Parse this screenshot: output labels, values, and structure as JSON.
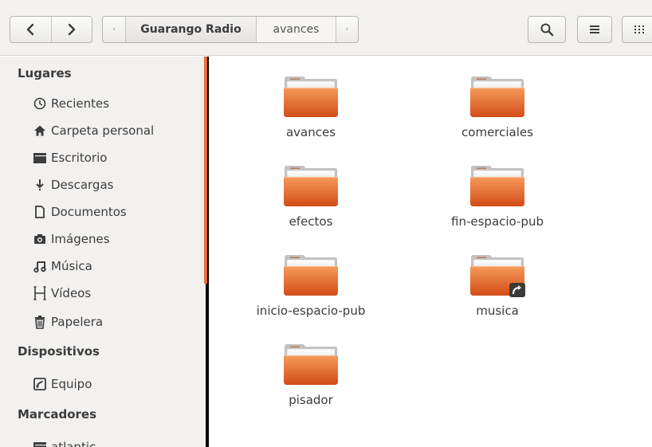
{
  "toolbar": {
    "back_icon": "chevron-left-icon",
    "forward_icon": "chevron-right-icon",
    "path_left_arrow": "‹",
    "path_right_arrow": "›",
    "breadcrumbs": [
      "Guarango Radio",
      "avances"
    ],
    "search_icon": "search-icon",
    "list_view_icon": "list-icon",
    "grid_view_icon": "grid-icon"
  },
  "sidebar": {
    "places_title": "Lugares",
    "places": [
      {
        "label": "Recientes",
        "icon": "clock-icon"
      },
      {
        "label": "Carpeta personal",
        "icon": "home-icon"
      },
      {
        "label": "Escritorio",
        "icon": "desktop-folder-icon"
      },
      {
        "label": "Descargas",
        "icon": "download-icon"
      },
      {
        "label": "Documentos",
        "icon": "document-icon"
      },
      {
        "label": "Imágenes",
        "icon": "camera-icon"
      },
      {
        "label": "Música",
        "icon": "music-icon"
      },
      {
        "label": "Vídeos",
        "icon": "film-icon"
      },
      {
        "label": "Papelera",
        "icon": "trash-icon"
      }
    ],
    "devices_title": "Dispositivos",
    "devices": [
      {
        "label": "Equipo",
        "icon": "drive-icon"
      }
    ],
    "bookmarks_title": "Marcadores",
    "bookmarks": [
      {
        "label": "atlantic",
        "icon": "folder-icon"
      }
    ]
  },
  "files": [
    {
      "name": "avances",
      "link": false
    },
    {
      "name": "comerciales",
      "link": false
    },
    {
      "name": "efectos",
      "link": false
    },
    {
      "name": "fin-espacio-pub",
      "link": false
    },
    {
      "name": "inicio-espacio-pub",
      "link": false
    },
    {
      "name": "musica",
      "link": true
    },
    {
      "name": "pisador",
      "link": false
    }
  ],
  "colors": {
    "accent": "#e56f3c",
    "folder_top": "#f08a4b",
    "folder_bottom": "#d9541b"
  }
}
